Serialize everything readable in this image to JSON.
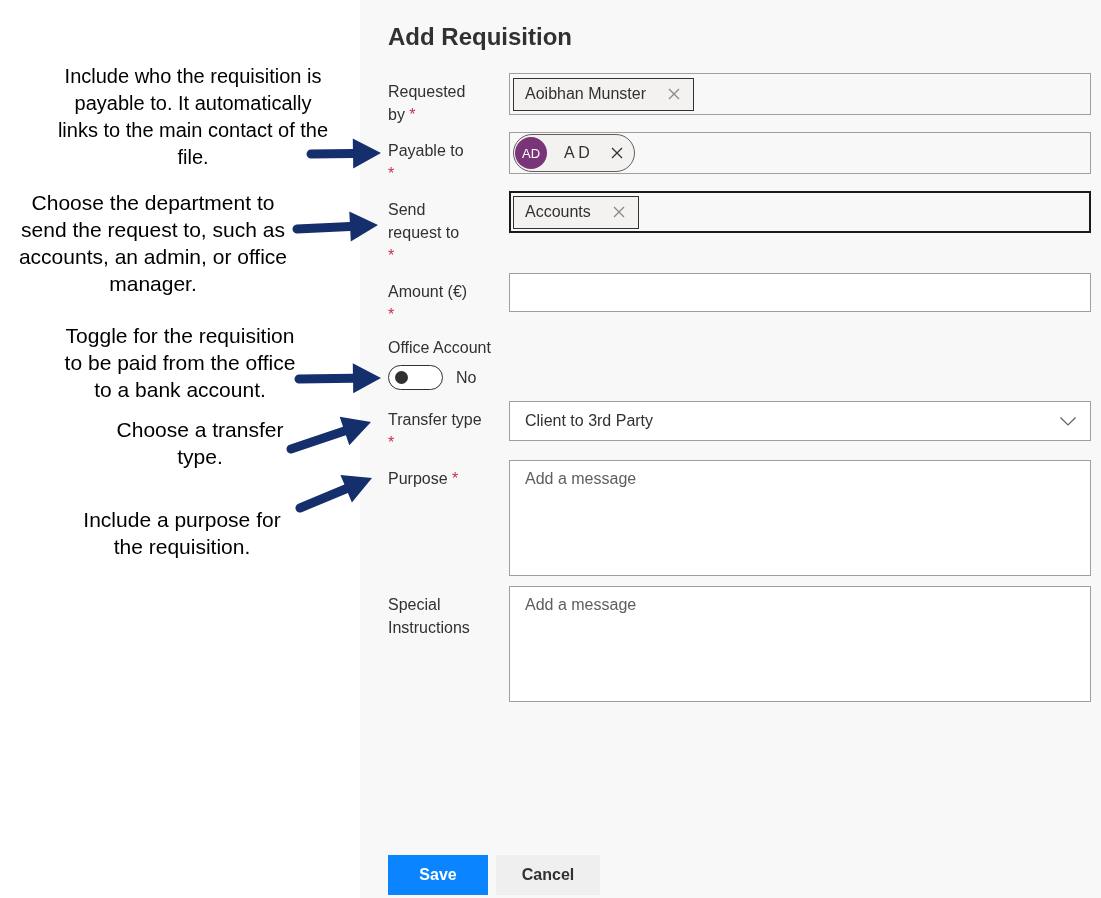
{
  "annotations": [
    {
      "text": "Include who the requisition is payable to. It automatically links to the main contact of the file."
    },
    {
      "text": "Choose the department to send the request to, such as accounts, an admin, or office manager."
    },
    {
      "text": "Toggle for the requisition to be paid from the office to a bank account."
    },
    {
      "text": "Choose a transfer type."
    },
    {
      "text": "Include a purpose for the requisition."
    }
  ],
  "form": {
    "title": "Add Requisition",
    "fields": [
      {
        "kind": "picker",
        "label": "Requested by",
        "required_mark": "*",
        "focused": false,
        "chips": [
          {
            "kind": "tag",
            "text": "Aoibhan Munster"
          }
        ]
      },
      {
        "kind": "picker",
        "label": "Payable to",
        "required_mark": "*",
        "focused": false,
        "chips": [
          {
            "kind": "persona",
            "initials": "AD",
            "text": "A D"
          }
        ]
      },
      {
        "kind": "picker",
        "label": "Send request to",
        "required_mark": "*",
        "focused": true,
        "chips": [
          {
            "kind": "tag",
            "text": "Accounts"
          }
        ]
      },
      {
        "kind": "text",
        "label": "Amount (€)",
        "required_mark": "*"
      },
      {
        "kind": "toggle",
        "label": "Office Account",
        "on": false,
        "state_text": "No"
      },
      {
        "kind": "dropdown",
        "label": "Transfer type",
        "required_mark": "*",
        "value": "Client to 3rd Party"
      },
      {
        "kind": "textarea",
        "label": "Purpose",
        "required_mark": "*",
        "placeholder": "Add a message"
      },
      {
        "kind": "textarea",
        "label": "Special Instructions",
        "placeholder": "Add a message"
      }
    ],
    "buttons": [
      {
        "kind": "primary",
        "label": "Save"
      },
      {
        "kind": "secondary",
        "label": "Cancel"
      }
    ]
  }
}
